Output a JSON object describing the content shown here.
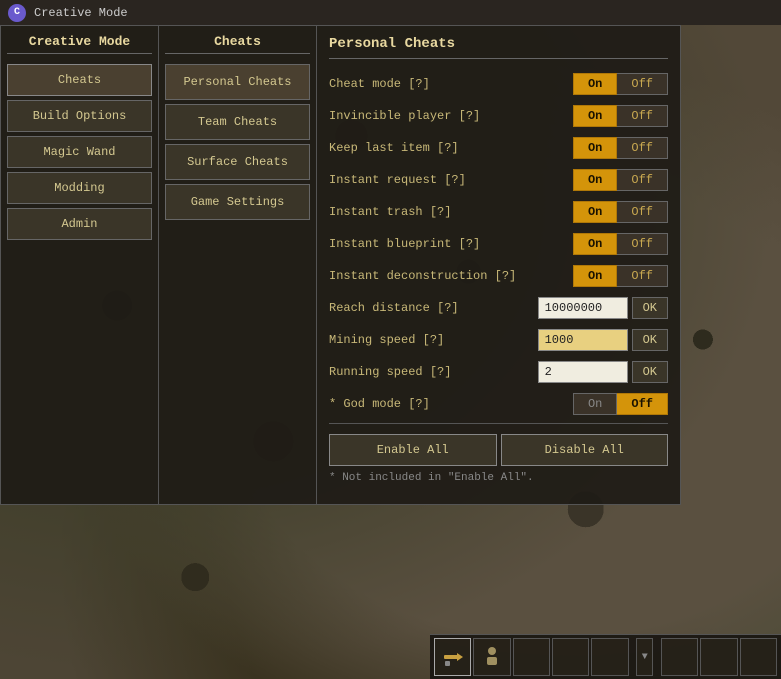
{
  "app": {
    "title": "Creative Mode",
    "icon_letter": "C"
  },
  "left_panel": {
    "title": "Creative Mode",
    "buttons": [
      {
        "label": "Cheats",
        "active": true
      },
      {
        "label": "Build Options",
        "active": false
      },
      {
        "label": "Magic Wand",
        "active": false
      },
      {
        "label": "Modding",
        "active": false
      },
      {
        "label": "Admin",
        "active": false
      }
    ]
  },
  "middle_panel": {
    "title": "Cheats",
    "buttons": [
      {
        "label": "Personal Cheats",
        "active": true
      },
      {
        "label": "Team Cheats",
        "active": false
      },
      {
        "label": "Surface Cheats",
        "active": false
      },
      {
        "label": "Game Settings",
        "active": false
      }
    ]
  },
  "right_panel": {
    "title": "Personal Cheats",
    "options": [
      {
        "label": "Cheat mode [?]",
        "type": "toggle",
        "value": "on"
      },
      {
        "label": "Invincible player [?]",
        "type": "toggle",
        "value": "on"
      },
      {
        "label": "Keep last item [?]",
        "type": "toggle",
        "value": "on"
      },
      {
        "label": "Instant request [?]",
        "type": "toggle",
        "value": "on"
      },
      {
        "label": "Instant trash [?]",
        "type": "toggle",
        "value": "on"
      },
      {
        "label": "Instant blueprint [?]",
        "type": "toggle",
        "value": "on"
      },
      {
        "label": "Instant deconstruction [?]",
        "type": "toggle",
        "value": "on"
      },
      {
        "label": "Reach distance [?]",
        "type": "input",
        "value": "10000000"
      },
      {
        "label": "Mining speed [?]",
        "type": "input",
        "value": "1000"
      },
      {
        "label": "Running speed [?]",
        "type": "input",
        "value": "2"
      },
      {
        "label": "* God mode [?]",
        "type": "toggle_off",
        "value": "off"
      }
    ],
    "on_label": "On",
    "off_label": "Off",
    "ok_label": "OK",
    "enable_all_label": "Enable All",
    "disable_all_label": "Disable All",
    "footnote": "* Not included in \"Enable All\"."
  }
}
